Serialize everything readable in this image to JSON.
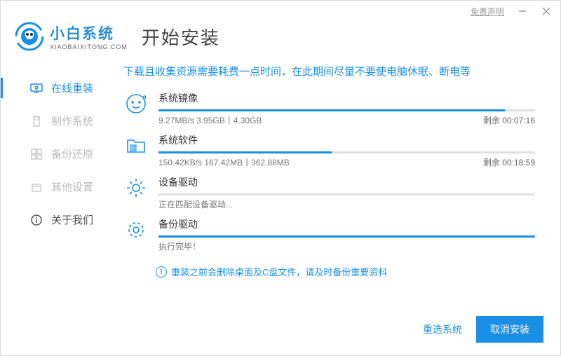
{
  "titlebar": {
    "disclaimer": "免责声明"
  },
  "brand": {
    "name": "小白系统",
    "url": "XIAOBAIXITONG.COM"
  },
  "page_title": "开始安装",
  "sidebar": {
    "items": [
      {
        "label": "在线重装"
      },
      {
        "label": "制作系统"
      },
      {
        "label": "备份还原"
      },
      {
        "label": "其他设置"
      },
      {
        "label": "关于我们"
      }
    ]
  },
  "tip": "下载且收集资源需要耗费一点时间，在此期间尽量不要使电脑休眠、断电等",
  "tasks": {
    "image": {
      "title": "系统镜像",
      "sub": "9.27MB/s 3.95GB丨4.30GB",
      "eta": "剩余 00:07:16",
      "pct": 92
    },
    "soft": {
      "title": "系统软件",
      "sub": "150.42KB/s 167.42MB丨362.88MB",
      "eta": "剩余 00:18:59",
      "pct": 46
    },
    "driver": {
      "title": "设备驱动",
      "sub": "正在匹配设备驱动...",
      "eta": "",
      "pct": 0
    },
    "backup": {
      "title": "备份驱动",
      "sub": "执行完毕！",
      "eta": "",
      "pct": 100
    }
  },
  "warning": "重装之前会删除桌面及C盘文件，请及时备份重要资料",
  "footer": {
    "reselect": "重选系统",
    "cancel": "取消安装"
  }
}
